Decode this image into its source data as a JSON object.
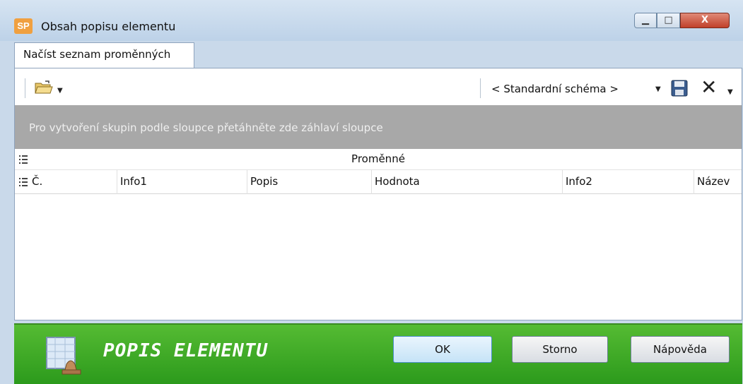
{
  "window": {
    "app_badge": "SP",
    "title": "Obsah popisu elementu",
    "minimize_icon": "minimize-icon",
    "maximize_icon": "maximize-icon",
    "close_label": "X"
  },
  "tabs": [
    {
      "label": "Načíst seznam proměnných",
      "active": true
    }
  ],
  "toolbar": {
    "open_icon": "folder-open-icon",
    "schema_value": "< Standardní schéma >",
    "save_icon": "floppy-disk-icon",
    "delete_icon": "close-x-icon"
  },
  "grid": {
    "group_hint": "Pro vytvoření skupin podle sloupce přetáhněte zde záhlaví sloupce",
    "band_title": "Proměnné",
    "columns": [
      "Č.",
      "Info1",
      "Popis",
      "Hodnota",
      "Info2",
      "Název"
    ],
    "rows": []
  },
  "footer": {
    "title": "POPIS ELEMENTU",
    "ok_label": "OK",
    "cancel_label": "Storno",
    "help_label": "Nápověda"
  },
  "colors": {
    "footer_green": "#3aa826",
    "group_area_gray": "#a8a8a8",
    "titlebar_blue": "#c9d9ea"
  }
}
